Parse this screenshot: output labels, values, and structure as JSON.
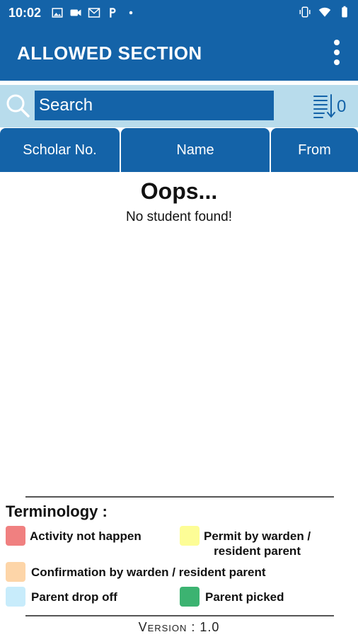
{
  "status_bar": {
    "time": "10:02",
    "left_icons": [
      "image-icon",
      "video-icon",
      "gmail-icon",
      "p-icon",
      "dot-icon"
    ],
    "right_icons": [
      "vibrate-icon",
      "wifi-icon",
      "battery-icon"
    ]
  },
  "app_bar": {
    "title": "ALLOWED SECTION",
    "menu_icon": "more-vert-icon"
  },
  "search": {
    "placeholder": "Search",
    "sort_count": "0"
  },
  "table": {
    "columns": [
      "Scholar No.",
      "Name",
      "From"
    ]
  },
  "empty_state": {
    "title": "Oops...",
    "message": "No student found!"
  },
  "terminology": {
    "title": "Terminology :",
    "items": [
      {
        "label": "Activity not happen",
        "color": "#f08080"
      },
      {
        "label": "Permit by warden /\nresident parent",
        "color": "#fdfd96"
      },
      {
        "label": "Confirmation by warden / resident parent",
        "color": "#fdd5a8"
      },
      {
        "label": "Parent drop off",
        "color": "#c8ecfb"
      },
      {
        "label": "Parent picked",
        "color": "#3cb371"
      }
    ]
  },
  "footer": {
    "version": "Version : 1.0"
  },
  "colors": {
    "primary": "#1463a8",
    "search_bg": "#b8dcec"
  }
}
